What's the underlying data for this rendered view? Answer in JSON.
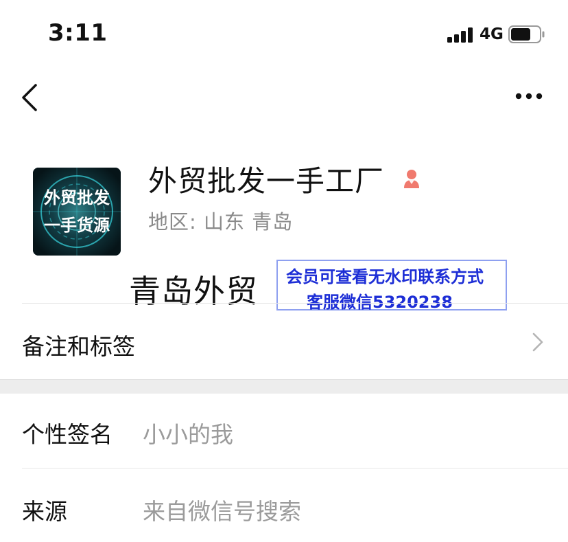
{
  "status_bar": {
    "time": "3:11",
    "network": "4G",
    "battery_level": 0.7
  },
  "nav": {
    "back_icon": "chevron-left-icon",
    "more_icon": "more-dots-icon"
  },
  "profile": {
    "name": "外贸批发一手工厂",
    "gender_icon": "female-person-icon",
    "region_label": "地区:",
    "region_value": "山东 青岛",
    "avatar_text_line1": "外贸批发",
    "avatar_text_line2": "一手货源"
  },
  "watermark": {
    "city_text": "青岛外贸",
    "line1": "会员可查看无水印联系方式",
    "line2": "客服微信5320238"
  },
  "rows": {
    "remarks_label": "备注和标签",
    "signature_label": "个性签名",
    "signature_value": "小小的我",
    "source_label": "来源",
    "source_value": "来自微信号搜索"
  },
  "colors": {
    "gender_female": "#f07a6e",
    "watermark_text": "#1d2ed6",
    "watermark_border": "#8ea0f0",
    "secondary_text": "#8a8a8a"
  }
}
